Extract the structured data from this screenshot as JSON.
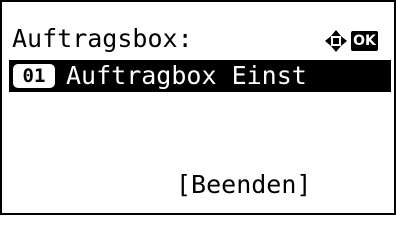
{
  "screen": {
    "title": "Auftragsbox:",
    "nav_icon": "four-way-arrow-icon",
    "ok_icon_label": "OK"
  },
  "menu": {
    "items": [
      {
        "number": "01",
        "label": "Auftragbox Einst",
        "selected": true
      }
    ]
  },
  "softkeys": {
    "end_label": "[Beenden]"
  },
  "colors": {
    "foreground": "#000000",
    "background": "#ffffff"
  }
}
